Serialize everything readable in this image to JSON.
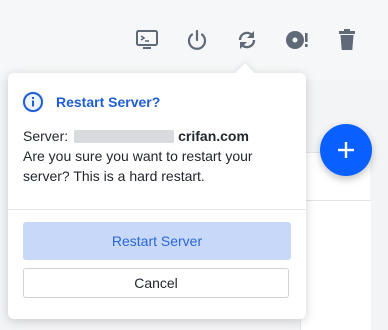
{
  "toolbar": {
    "icons": [
      "console-icon",
      "power-icon",
      "restart-icon",
      "disk-icon",
      "trash-icon"
    ]
  },
  "dialog": {
    "title": "Restart Server?",
    "server_label": "Server:",
    "server_domain": "crifan.com",
    "message": "Are you sure you want to restart your server? This is a hard restart.",
    "confirm_label": "Restart Server",
    "cancel_label": "Cancel"
  },
  "fab": {
    "icon": "plus-icon"
  },
  "colors": {
    "accent": "#1f5fd6",
    "fab": "#0a60ff",
    "confirm_bg": "#c7d8f8",
    "icon_gray": "#5f6977"
  }
}
